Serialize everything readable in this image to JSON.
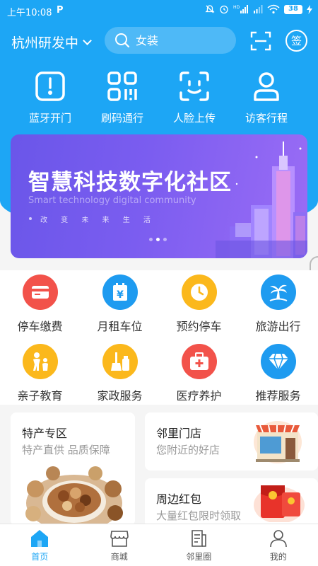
{
  "status_bar": {
    "time": "上午10:08",
    "app_badge": "P",
    "battery": "38"
  },
  "header": {
    "city": "杭州研发中",
    "search_placeholder": "女装",
    "sign_label": "签"
  },
  "quick_actions": [
    {
      "label": "蓝牙开门",
      "icon": "bluetooth-door-icon"
    },
    {
      "label": "刷码通行",
      "icon": "qr-pass-icon"
    },
    {
      "label": "人脸上传",
      "icon": "face-scan-icon"
    },
    {
      "label": "访客行程",
      "icon": "visitor-icon"
    }
  ],
  "banner": {
    "title": "智慧科技数字化社区",
    "subtitle": "Smart technology digital community",
    "slogan": "改 变 未 来 生 活",
    "page_count": 3,
    "active_page": 2
  },
  "services": [
    {
      "label": "停车缴费",
      "icon": "parking-pay-icon",
      "color": "#f2524a"
    },
    {
      "label": "月租车位",
      "icon": "monthly-parking-icon",
      "color": "#1e9bf0"
    },
    {
      "label": "预约停车",
      "icon": "clock-icon",
      "color": "#fbb81c"
    },
    {
      "label": "旅游出行",
      "icon": "palm-tree-icon",
      "color": "#1e9bf0"
    },
    {
      "label": "亲子教育",
      "icon": "parent-child-icon",
      "color": "#fbb81c"
    },
    {
      "label": "家政服务",
      "icon": "cleaning-icon",
      "color": "#fbb81c"
    },
    {
      "label": "医疗养护",
      "icon": "medical-kit-icon",
      "color": "#f2524a"
    },
    {
      "label": "推荐服务",
      "icon": "diamond-icon",
      "color": "#1e9bf0"
    }
  ],
  "cards": {
    "specialty": {
      "title": "特产专区",
      "subtitle": "特产直供 品质保障"
    },
    "store": {
      "title": "邻里门店",
      "subtitle": "您附近的好店"
    },
    "redpacket": {
      "title": "周边红包",
      "subtitle": "大量红包限时领取"
    }
  },
  "bottom_nav": [
    {
      "label": "首页",
      "active": true
    },
    {
      "label": "商城",
      "active": false
    },
    {
      "label": "邻里圈",
      "active": false
    },
    {
      "label": "我的",
      "active": false
    }
  ],
  "colors": {
    "primary": "#1da6f5",
    "red": "#f2524a",
    "blue": "#1e9bf0",
    "yellow": "#fbb81c"
  }
}
